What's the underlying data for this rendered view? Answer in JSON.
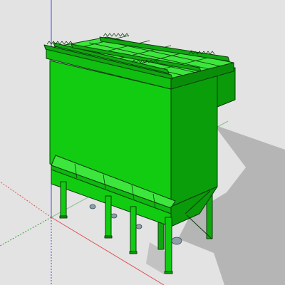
{
  "viewport": {
    "background": "#e3e3e3",
    "colors": {
      "model_green": "#10cc10",
      "model_green_dark": "#0a9a0a",
      "model_green_light": "#3de63d",
      "edge": "#0c3b0c",
      "shadow": "#b5b5b5",
      "axis_blue": "#4a4af0",
      "axis_green": "#2da52d",
      "axis_red": "#e05050"
    },
    "model": {
      "name": "dust-collector-filter-house"
    }
  }
}
